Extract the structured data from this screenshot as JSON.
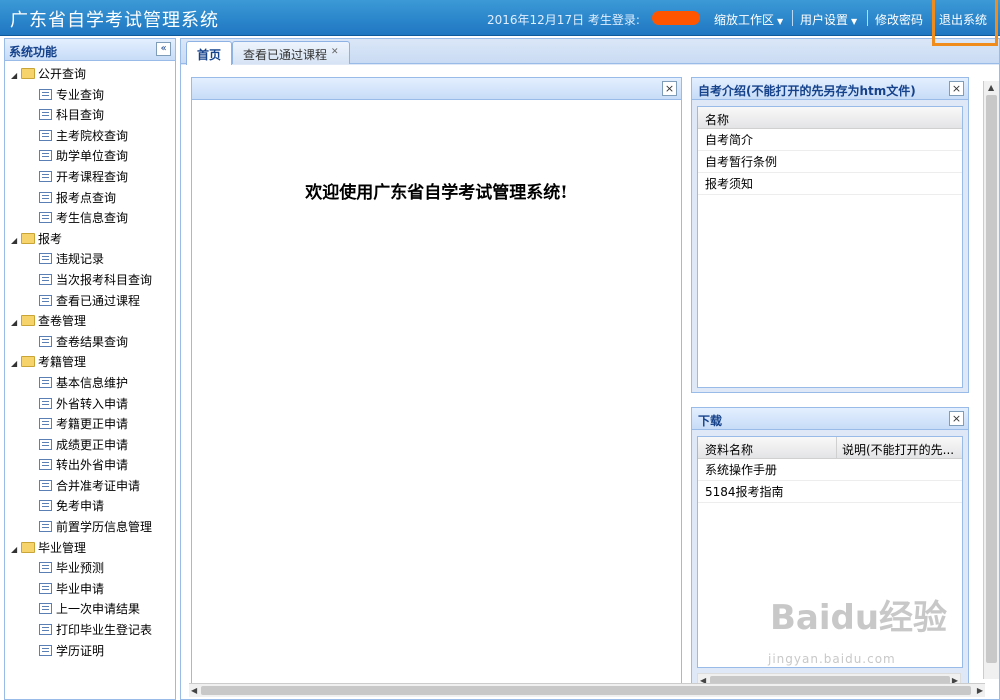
{
  "header": {
    "title": "广东省自学考试管理系统",
    "date": "2016年12月17日",
    "login_label": "考生登录:",
    "menus": [
      "缩放工作区",
      "用户设置",
      "修改密码"
    ],
    "exit_label": "退出系统"
  },
  "sidebar": {
    "title": "系统功能",
    "collapse": "«",
    "groups": [
      {
        "label": "公开查询",
        "items": [
          "专业查询",
          "科目查询",
          "主考院校查询",
          "助学单位查询",
          "开考课程查询",
          "报考点查询",
          "考生信息查询"
        ]
      },
      {
        "label": "报考",
        "items": [
          "违规记录",
          "当次报考科目查询",
          "查看已通过课程"
        ]
      },
      {
        "label": "查卷管理",
        "items": [
          "查卷结果查询"
        ]
      },
      {
        "label": "考籍管理",
        "items": [
          "基本信息维护",
          "外省转入申请",
          "考籍更正申请",
          "成绩更正申请",
          "转出外省申请",
          "合并准考证申请",
          "免考申请",
          "前置学历信息管理"
        ]
      },
      {
        "label": "毕业管理",
        "items": [
          "毕业预测",
          "毕业申请",
          "上一次申请结果",
          "打印毕业生登记表",
          "学历证明"
        ]
      }
    ]
  },
  "tabs": [
    {
      "label": "首页"
    },
    {
      "label": "查看已通过课程"
    }
  ],
  "welcome": {
    "text": "欢迎使用广东省自学考试管理系统!"
  },
  "intro_panel": {
    "title": "自考介绍(不能打开的先另存为htm文件)",
    "column": "名称",
    "rows": [
      "自考简介",
      "自考暂行条例",
      "报考须知"
    ]
  },
  "download_panel": {
    "title": "下载",
    "columns": [
      "资料名称",
      "说明(不能打开的先..."
    ],
    "rows": [
      "系统操作手册",
      "5184报考指南"
    ]
  },
  "icons": {
    "close": "×",
    "caret": "▾",
    "expand": "◢"
  },
  "watermark": {
    "logo": "Baidu经验",
    "url": "jingyan.baidu.com"
  }
}
